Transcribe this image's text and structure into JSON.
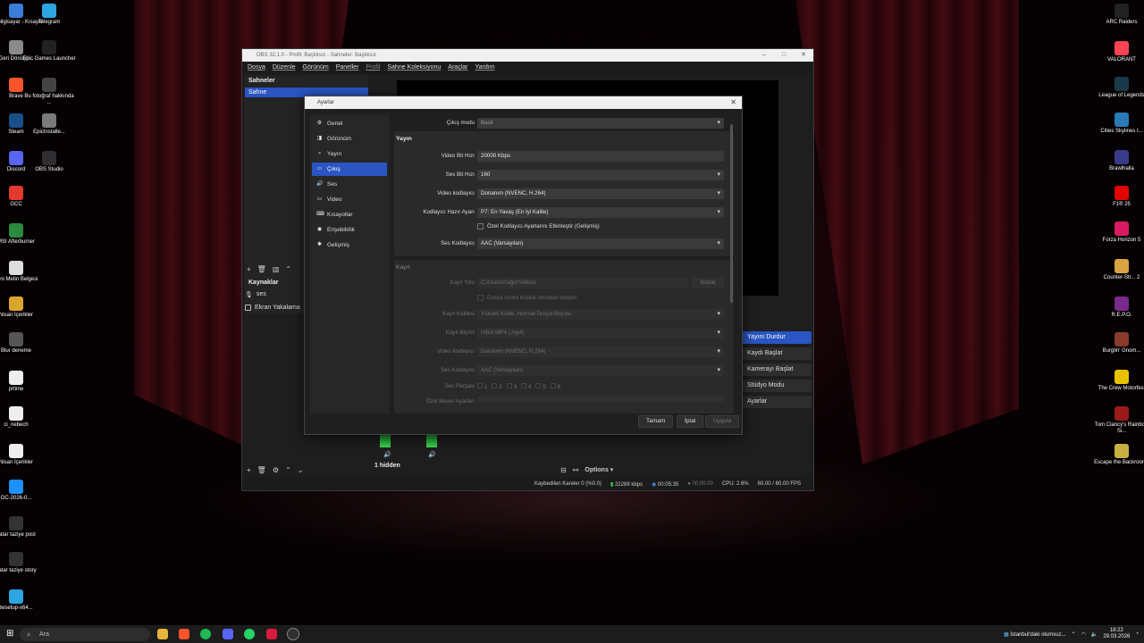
{
  "desktop": {
    "left_icons": [
      {
        "label": "Bu bilgisayar - Kısayol",
        "color": "#3b7dd8"
      },
      {
        "label": "Telegram",
        "color": "#2ca5e0"
      },
      {
        "label": "Geri Dönüşü...",
        "color": "#8a8a8a"
      },
      {
        "label": "Epic Games Launcher",
        "color": "#222222"
      },
      {
        "label": "Brave",
        "color": "#fb542b"
      },
      {
        "label": "Bu fotoğraf hakkında ...",
        "color": "#444444"
      },
      {
        "label": "Steam",
        "color": "#1b4f8a"
      },
      {
        "label": "EpicInstalle...",
        "color": "#7a7a7a"
      },
      {
        "label": "Discord",
        "color": "#5865f2"
      },
      {
        "label": "OBS Studio",
        "color": "#302e31"
      },
      {
        "label": "GCC",
        "color": "#e23a2e"
      },
      {
        "label": "MSI Afterburner",
        "color": "#2b8a3e"
      },
      {
        "label": "Yeni Metin Belgesi",
        "color": "#dddddd"
      },
      {
        "label": "Nisan İçerikler",
        "color": "#d9a52b"
      },
      {
        "label": "Blur deneme",
        "color": "#555555"
      },
      {
        "label": "prtime",
        "color": "#eeeeee"
      },
      {
        "label": "ci_nebech",
        "color": "#eeeeee"
      },
      {
        "label": "Nisan İçerikler",
        "color": "#eeeeee"
      },
      {
        "label": "OC-2026-0...",
        "color": "#1e90ff"
      },
      {
        "label": "katar taziye post",
        "color": "#333333"
      },
      {
        "label": "katar taziye story",
        "color": "#333333"
      },
      {
        "label": "twsetup-x64...",
        "color": "#2ca5e0"
      }
    ],
    "right_icons": [
      {
        "label": "ARC Raiders",
        "color": "#222222"
      },
      {
        "label": "VALORANT",
        "color": "#fa4454"
      },
      {
        "label": "League of Legends",
        "color": "#1a3a4a"
      },
      {
        "label": "Cities Skylines I...",
        "color": "#2a7ab8"
      },
      {
        "label": "Brawlhalla",
        "color": "#3a3a8a"
      },
      {
        "label": "F1® 25",
        "color": "#e10600"
      },
      {
        "label": "Forza Horizon 5",
        "color": "#d81b60"
      },
      {
        "label": "Counter-Str... 2",
        "color": "#d9a441"
      },
      {
        "label": "R.E.P.O.",
        "color": "#7a2a8a"
      },
      {
        "label": "Burglin' Gnom...",
        "color": "#8a3a2a"
      },
      {
        "label": "The Crew Motorfest",
        "color": "#e8c200"
      },
      {
        "label": "Tom Clancy's Rainbow Si...",
        "color": "#9a1a1a"
      },
      {
        "label": "Escape the Backrooms",
        "color": "#c8b040"
      }
    ]
  },
  "obs": {
    "title": "OBS 32.1.0 - Profil: Başlıksız - Sahneler: Başlıksız",
    "menu": [
      "Dosya",
      "Düzenle",
      "Görünüm",
      "Paneller",
      "Profil",
      "Sahne Koleksiyonu",
      "Araçlar",
      "Yardım"
    ],
    "scenes_title": "Sahneler",
    "scene_items": [
      "Sahne"
    ],
    "sources_title": "Kaynaklar",
    "sources": [
      "ses",
      "Ekran Yakalama"
    ],
    "controls": [
      "Yayını Durdur",
      "Kaydı Başlat",
      "Kamerayı Başlat",
      "Stüdyo Modu",
      "Ayarlar"
    ],
    "hidden_label": "1 hidden",
    "options_label": "Options",
    "status": {
      "dropped": "Kaybedilen Kareler 0 (%0.0)",
      "bitrate": "22289 kbps",
      "stream_time": "00:05:35",
      "rec_time": "00:00:00",
      "cpu": "CPU: 2.6%",
      "fps": "60.00 / 60.00 FPS"
    }
  },
  "settings": {
    "title": "Ayarlar",
    "nav": [
      {
        "label": "Genel",
        "icon": "gear-icon"
      },
      {
        "label": "Görünüm",
        "icon": "appearance-icon"
      },
      {
        "label": "Yayın",
        "icon": "stream-icon"
      },
      {
        "label": "Çıkış",
        "icon": "output-icon"
      },
      {
        "label": "Ses",
        "icon": "speaker-icon"
      },
      {
        "label": "Video",
        "icon": "monitor-icon"
      },
      {
        "label": "Kısayollar",
        "icon": "keyboard-icon"
      },
      {
        "label": "Erişebilirlik",
        "icon": "accessibility-icon"
      },
      {
        "label": "Gelişmiş",
        "icon": "wrench-icon"
      }
    ],
    "selected_nav": "Çıkış",
    "output_mode": {
      "label": "Çıkış modu",
      "value": "Basit"
    },
    "stream": {
      "title": "Yayın",
      "video_bitrate": {
        "label": "Video Bit Hızı",
        "value": "20000 Kbps"
      },
      "audio_bitrate": {
        "label": "Ses Bit Hızı",
        "value": "160"
      },
      "video_encoder": {
        "label": "Video kodlayıcı",
        "value": "Donanım (NVENC, H.264)"
      },
      "encoder_preset": {
        "label": "Kodlayıcı Hazır Ayarı",
        "value": "P7: En Yavaş (En İyi Kalite)"
      },
      "custom_encoder_check": "Özel Kodlayıcı Ayarlarını Etkinleştir (Gelişmiş)",
      "audio_encoder": {
        "label": "Ses Kodlayıcı",
        "value": "AAC (Varsayılan)"
      }
    },
    "recording": {
      "title": "Kayıt",
      "path": {
        "label": "Kayıt Yolu",
        "value": "C:\\Users\\Yağız\\Videos"
      },
      "browse": "Gözat",
      "no_space_check": "Dosya ismini boşluk olmadan oluştur",
      "quality": {
        "label": "Kayıt Kalitesi",
        "value": "Yüksek Kalite, Normal Dosya Boyutu"
      },
      "format": {
        "label": "Kayıt Biçimi",
        "value": "Hibrit MP4 (.mp4)"
      },
      "video_encoder": {
        "label": "Video kodlayıcı",
        "value": "Donanım (NVENC, H.264)"
      },
      "audio_encoder": {
        "label": "Ses Kodlayıcı",
        "value": "AAC (Varsayılan)"
      },
      "tracks_label": "Ses Parçası",
      "tracks": [
        "1",
        "2",
        "3",
        "4",
        "5",
        "6"
      ],
      "muxer_label": "Özel Muxer Ayarları"
    },
    "buttons": {
      "ok": "Tamam",
      "cancel": "İptal",
      "apply": "Uygula"
    }
  },
  "taskbar": {
    "search_placeholder": "Ara",
    "weather": "İstanbul'daki olumsuz...",
    "time": "18:22",
    "date": "29.03.2026"
  },
  "colors": {
    "accent": "#2a55c2",
    "dialog_bg": "#1f1f1f"
  }
}
